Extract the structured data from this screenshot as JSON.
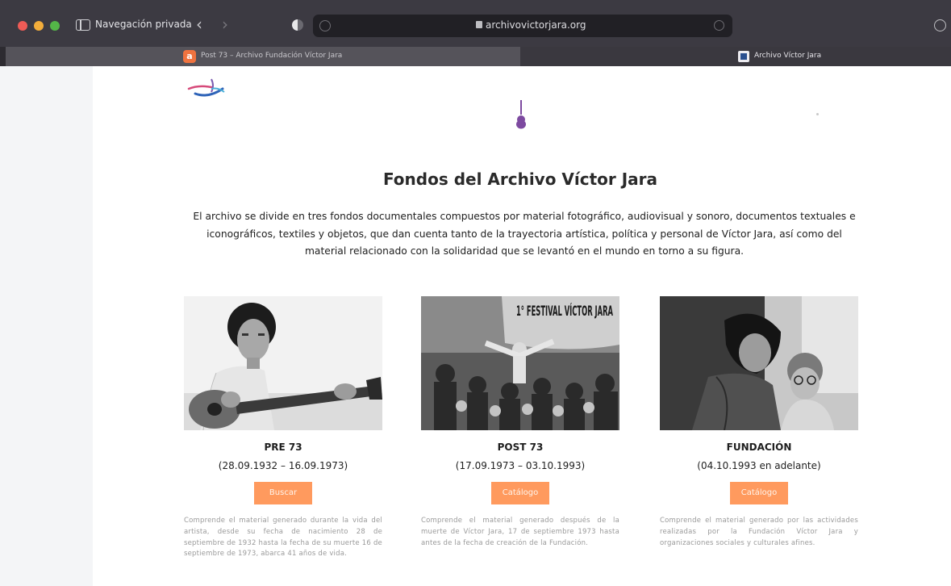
{
  "browser": {
    "private_label": "Navegación privada",
    "url": "archivovictorjara.org",
    "tabs": [
      {
        "title": "Post 73 – Archivo Fundación Víctor Jara",
        "active": true
      },
      {
        "title": "Archivo Víctor Jara",
        "active": false
      }
    ],
    "icons": [
      "sidebar-icon",
      "back-arrow-icon",
      "forward-arrow-icon",
      "shield-icon",
      "lock-icon",
      "reload-icon",
      "downloads-icon"
    ]
  },
  "page": {
    "title": "Fondos del Archivo Víctor Jara",
    "intro": "El archivo se divide en tres fondos documentales compuestos por material fotográfico, audiovisual y sonoro, documentos textuales e iconográficos, textiles y objetos, que dan cuenta tanto de la trayectoria artística, política y personal de Víctor Jara, así como del material relacionado con la solidaridad que se levantó en el mundo en torno a su figura.",
    "accent_color": "#ff9a5e",
    "cards": [
      {
        "title": "PRE 73",
        "dates": "(28.09.1932 – 16.09.1973)",
        "button": "Buscar",
        "description": "Comprende el material generado durante la vida del artista, desde su fecha de nacimiento 28 de septiembre de 1932 hasta la fecha de su muerte 16 de septiembre de 1973, abarca 41 años de vida."
      },
      {
        "title": "POST 73",
        "dates": "(17.09.1973 – 03.10.1993)",
        "button": "Catálogo",
        "image_text": "1° FESTIVAL VÍCTOR JARA",
        "description": "Comprende el material generado después de la muerte de Víctor Jara, 17 de septiembre 1973 hasta antes de la fecha de creación de la Fundación."
      },
      {
        "title": "FUNDACIÓN",
        "dates": "(04.10.1993 en adelante)",
        "button": "Catálogo",
        "description": "Comprende el material generado por las actividades realizadas por la Fundación Víctor Jara y organizaciones sociales y culturales afines."
      }
    ]
  }
}
